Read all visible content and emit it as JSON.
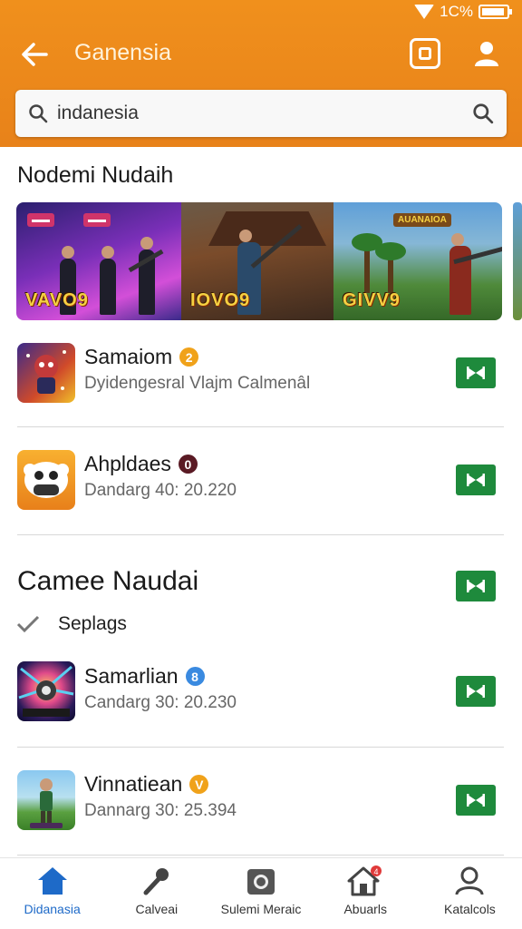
{
  "status": {
    "battery_text": "1C%"
  },
  "header": {
    "title": "Ganensia"
  },
  "search": {
    "value": "indanesia",
    "placeholder": "indanesia"
  },
  "section1": {
    "title": "Nodemi Nudaih"
  },
  "banners": [
    {
      "logo": "VAVO9",
      "tag": ""
    },
    {
      "logo": "IOVO9",
      "tag": ""
    },
    {
      "logo": "GIVV9",
      "tag": "AUANAIOA"
    }
  ],
  "apps_top": [
    {
      "name": "Samaiom",
      "badge": "2",
      "badge_color": "#f0a21a",
      "desc": "Dyidengesral Vlajm Calmenâl",
      "icon": "game-character-icon"
    },
    {
      "name": "Ahpldaes",
      "badge": "0",
      "badge_color": "#5a1a24",
      "desc": "Dandarg 40:  20.220",
      "icon": "robot-face-icon"
    }
  ],
  "section2": {
    "title": "Camee Naudai",
    "check_label": "Seplags"
  },
  "apps_bottom": [
    {
      "name": "Samarlian",
      "badge": "8",
      "badge_color": "#3a8ae0",
      "desc": "Candarg 30:  20.230",
      "icon": "planet-burst-icon"
    },
    {
      "name": "Vinnatiean",
      "badge": "V",
      "badge_color": "#f0a21a",
      "desc": "Dannarg 30:  25.394",
      "icon": "soldier-icon"
    }
  ],
  "nav": [
    {
      "label": "Didanasia",
      "icon": "home-icon",
      "active": true
    },
    {
      "label": "Calveai",
      "icon": "microphone-icon",
      "active": false
    },
    {
      "label": "Sulemi Meraic",
      "icon": "camera-icon",
      "active": false
    },
    {
      "label": "Abuarls",
      "icon": "house-notification-icon",
      "active": false
    },
    {
      "label": "Katalcols",
      "icon": "person-icon",
      "active": false
    }
  ],
  "colors": {
    "header": "#e8821a",
    "install": "#1e8a3c",
    "nav_active": "#1e6ac8"
  }
}
